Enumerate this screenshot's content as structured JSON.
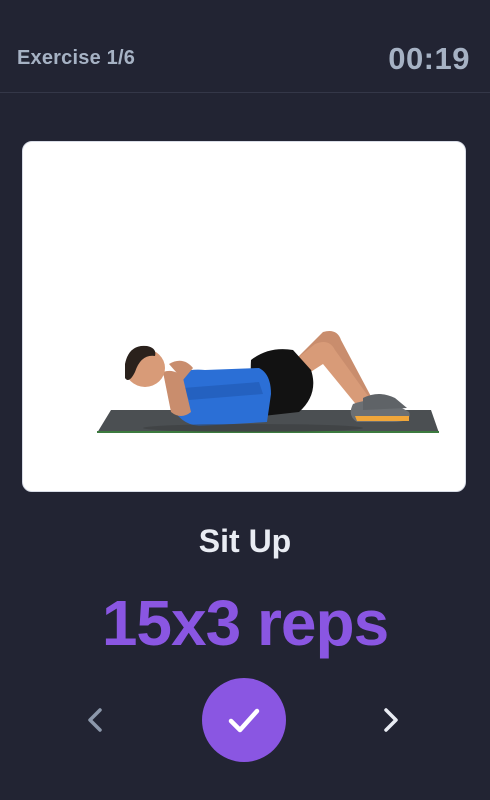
{
  "header": {
    "exercise_counter": "Exercise 1/6",
    "timer": "00:19"
  },
  "exercise": {
    "image_alt": "Sit Up exercise illustration",
    "name": "Sit Up",
    "reps": "15x3 reps"
  },
  "controls": {
    "prev_icon": "chevron-left-icon",
    "done_icon": "checkmark-icon",
    "next_icon": "chevron-right-icon"
  },
  "colors": {
    "background": "#222433",
    "accent": "#8a56e2",
    "muted_text": "#a6b2c4",
    "title_text": "#e9ecf3"
  }
}
